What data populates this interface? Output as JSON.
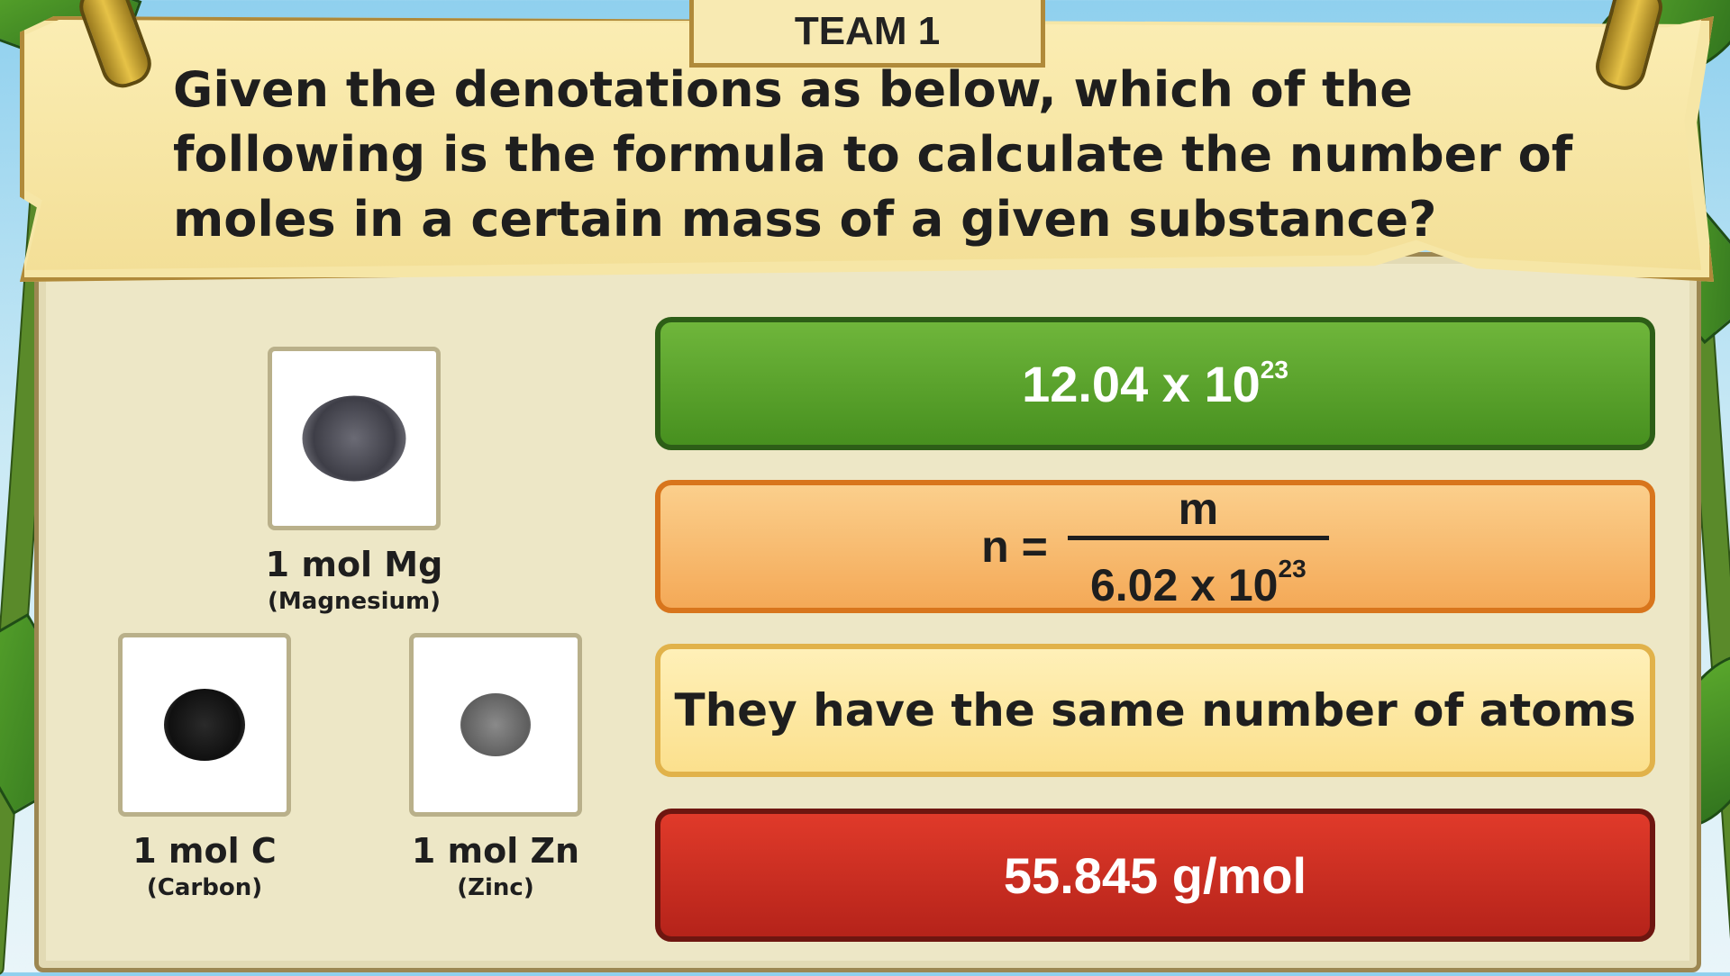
{
  "banner": {
    "team_label": "TEAM 1",
    "question": "Given the denotations as below, which of the following is the formula to calculate the number of moles in a certain mass of a given substance?"
  },
  "samples": [
    {
      "name": "1 mol Mg",
      "sub": "(Magnesium)",
      "color": "#4a4a52"
    },
    {
      "name": "1 mol C",
      "sub": "(Carbon)",
      "color": "#1a1a1a"
    },
    {
      "name": "1 mol Zn",
      "sub": "(Zinc)",
      "color": "#6e6e6e"
    }
  ],
  "answers": {
    "a1": {
      "base": "12.04 x 10",
      "exp": "23",
      "color": "#5aa22c"
    },
    "a2": {
      "lhs": "n =",
      "numerator": "m",
      "den_base": "6.02 x 10",
      "den_exp": "23",
      "color": "#f7b86a"
    },
    "a3": {
      "text": "They have the same number of atoms",
      "color": "#fde79f"
    },
    "a4": {
      "text": "55.845 g/mol",
      "color": "#cd2d20"
    }
  }
}
